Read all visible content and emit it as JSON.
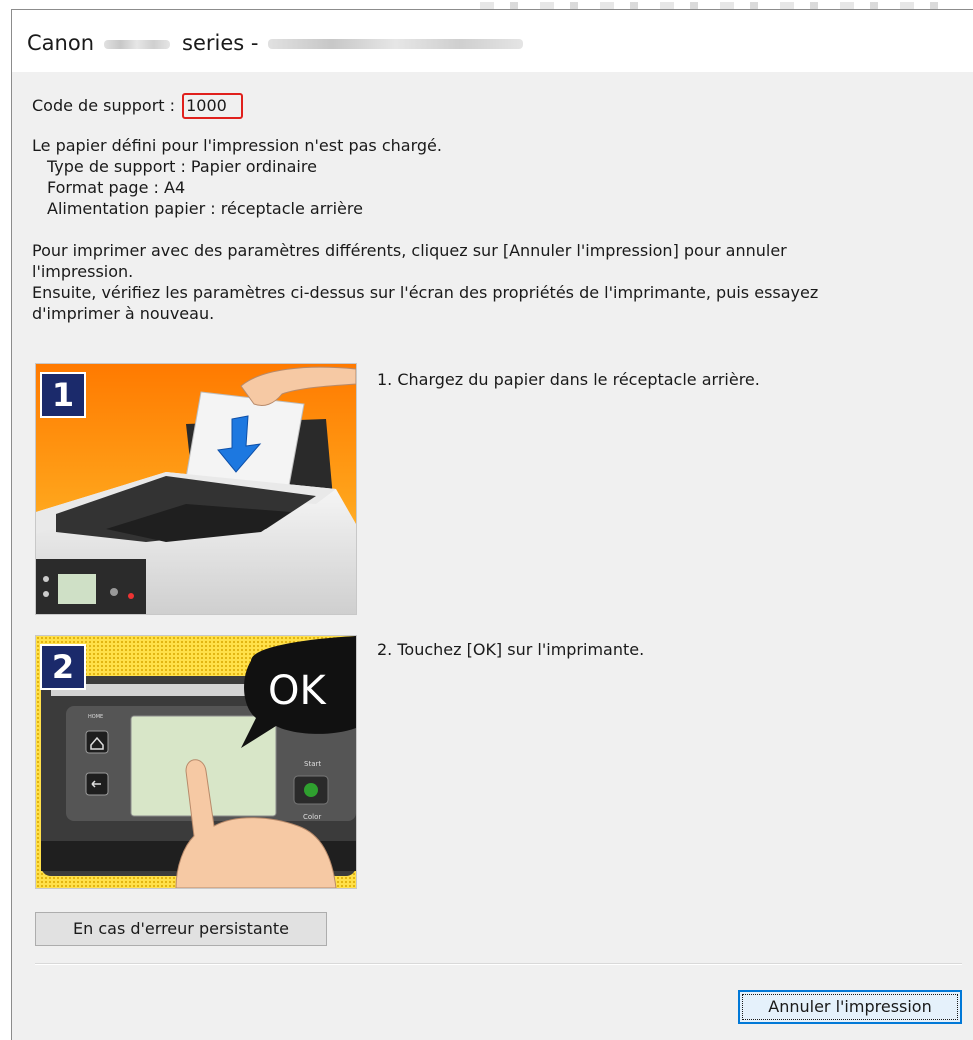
{
  "window": {
    "title_prefix": "Canon",
    "title_middle": "series -"
  },
  "support": {
    "label": "Code de support : ",
    "code": "1000"
  },
  "message": {
    "line1": "Le papier défini pour l'impression n'est pas chargé.",
    "line2": "Type de support : Papier ordinaire",
    "line3": "Format page : A4",
    "line4": "Alimentation papier : réceptacle arrière"
  },
  "instructions": {
    "line1": "Pour imprimer avec des paramètres différents, cliquez sur [Annuler l'impression] pour annuler",
    "line2": "l'impression.",
    "line3": "Ensuite, vérifiez les paramètres ci-dessus sur l'écran des propriétés de l'imprimante, puis essayez",
    "line4": "d'imprimer à nouveau."
  },
  "steps": [
    {
      "badge": "1",
      "text": "1.  Chargez du papier dans le réceptacle arrière."
    },
    {
      "badge": "2",
      "text": "2.  Touchez [OK] sur l'imprimante.",
      "bubble_text": "OK",
      "panel_labels": {
        "home": "HOME",
        "start": "Start",
        "color": "Color"
      }
    }
  ],
  "buttons": {
    "persistent_error": "En cas d'erreur persistante",
    "cancel_print": "Annuler l'impression"
  },
  "colors": {
    "code_highlight": "#e0201c",
    "badge": "#1b2a6b",
    "default_button_border": "#0078d7"
  }
}
